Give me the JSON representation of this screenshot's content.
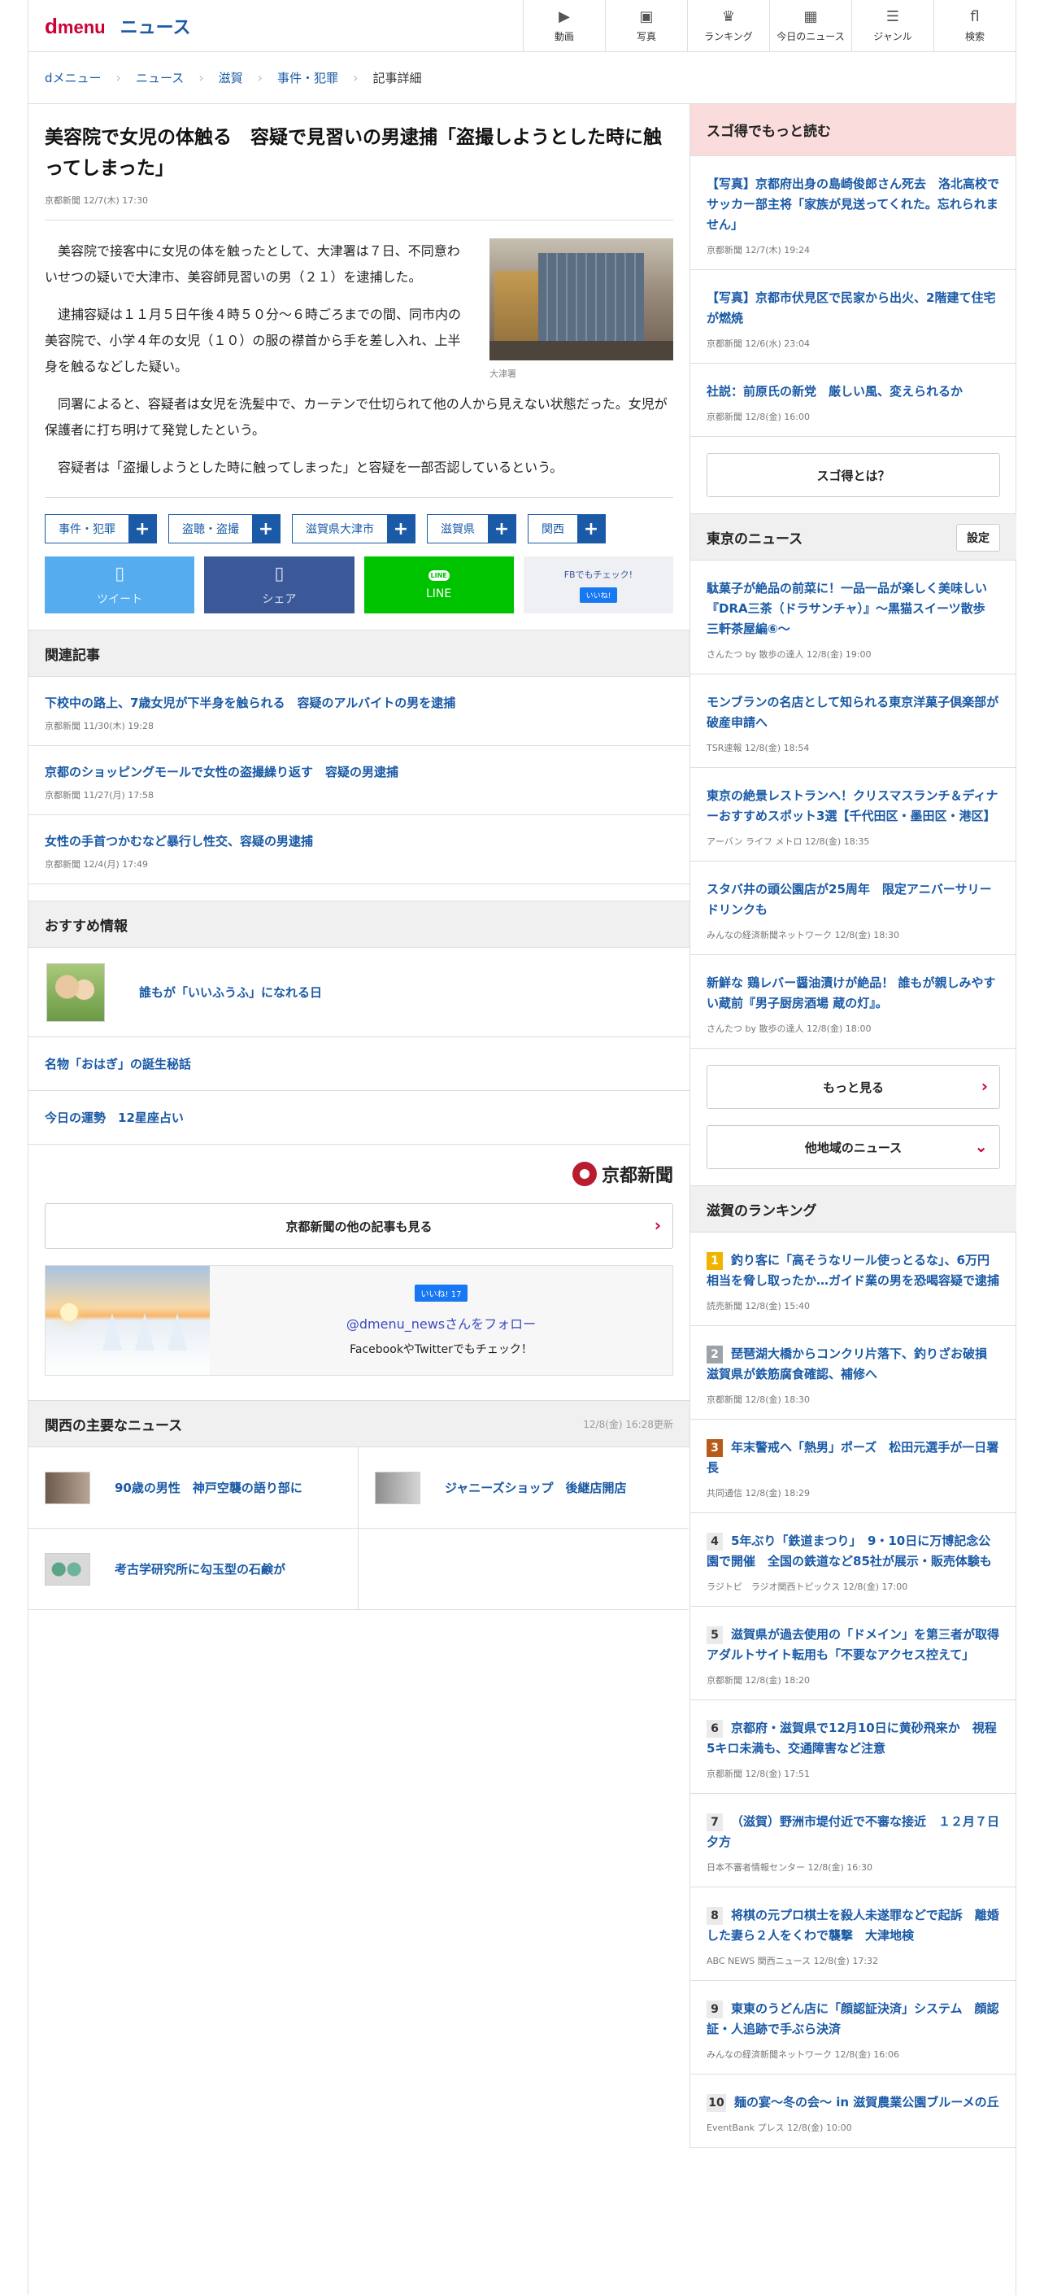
{
  "header": {
    "logo_d": "d",
    "logo_menu": "menu",
    "logo_news": "ニュース",
    "nav": [
      {
        "icon": "video-icon",
        "glyph": "▶",
        "label": "動画"
      },
      {
        "icon": "photo-icon",
        "glyph": "▣",
        "label": "写真"
      },
      {
        "icon": "ranking-icon",
        "glyph": "♛",
        "label": "ランキング"
      },
      {
        "icon": "calendar-icon",
        "glyph": "▦",
        "label": "今日のニュース"
      },
      {
        "icon": "genre-icon",
        "glyph": "☰",
        "label": "ジャンル"
      },
      {
        "icon": "search-icon",
        "glyph": "fl",
        "label": "検索"
      }
    ]
  },
  "breadcrumb": [
    "dメニュー",
    "ニュース",
    "滋賀",
    "事件・犯罪",
    "記事詳細"
  ],
  "article": {
    "title": "美容院で女児の体触る　容疑で見習いの男逮捕「盗撮しようとした時に触ってしまった」",
    "meta": "京都新聞 12/7(木) 17:30",
    "photo_caption": "大津署",
    "paragraphs": [
      "美容院で接客中に女児の体を触ったとして、大津署は７日、不同意わいせつの疑いで大津市、美容師見習いの男（２１）を逮捕した。",
      "逮捕容疑は１１月５日午後４時５０分～６時ごろまでの間、同市内の美容院で、小学４年の女児（１０）の服の襟首から手を差し入れ、上半身を触るなどした疑い。",
      "同署によると、容疑者は女児を洗髪中で、カーテンで仕切られて他の人から見えない状態だった。女児が保護者に打ち明けて発覚したという。",
      "容疑者は「盗撮しようとした時に触ってしまった」と容疑を一部否認しているという。"
    ],
    "tags": [
      "事件・犯罪",
      "盗聴・盗撮",
      "滋賀県大津市",
      "滋賀県",
      "関西"
    ],
    "share": {
      "tweet": "ツイート",
      "share": "シェア",
      "line_badge": "LINE",
      "line": "LINE",
      "fb_check": "FBでもチェック!",
      "fb_like": "いいね!"
    }
  },
  "related": {
    "heading": "関連記事",
    "items": [
      {
        "title": "下校中の路上、7歳女児が下半身を触られる　容疑のアルバイトの男を逮捕",
        "meta": "京都新聞 11/30(木) 19:28"
      },
      {
        "title": "京都のショッピングモールで女性の盗撮繰り返す　容疑の男逮捕",
        "meta": "京都新聞 11/27(月) 17:58"
      },
      {
        "title": "女性の手首つかむなど暴行し性交、容疑の男逮捕",
        "meta": "京都新聞 12/4(月) 17:49"
      }
    ]
  },
  "recommend": {
    "heading": "おすすめ情報",
    "items": [
      "誰もが「いいふうふ」になれる日",
      "名物「おはぎ」の誕生秘話",
      "今日の運勢　12星座占い"
    ]
  },
  "publisher": {
    "logo_text": "京都新聞",
    "more": "京都新聞の他の記事も見る"
  },
  "follow": {
    "like": "いいね! 17",
    "handle": "@dmenu_newsさんをフォロー",
    "note": "FacebookやTwitterでもチェック！"
  },
  "kansai": {
    "heading": "関西の主要なニュース",
    "time": "12/8(金) 16:28更新",
    "items": [
      "90歳の男性　神戸空襲の語り部に",
      "ジャニーズショップ　後継店開店",
      "考古学研究所に勾玉型の石鹸が"
    ]
  },
  "sidebar": {
    "sugo_heading": "スゴ得でもっと読む",
    "sugo_items": [
      {
        "title": "【写真】京都府出身の島崎俊郎さん死去　洛北高校でサッカー部主将「家族が見送ってくれた。忘れられません」",
        "meta": "京都新聞 12/7(木) 19:24"
      },
      {
        "title": "【写真】京都市伏見区で民家から出火、2階建て住宅が燃焼",
        "meta": "京都新聞 12/6(水) 23:04"
      },
      {
        "title": "社説：前原氏の新党　厳しい風、変えられるか",
        "meta": "京都新聞 12/8(金) 16:00"
      }
    ],
    "sugo_button": "スゴ得とは？",
    "tokyo_heading": "東京のニュース",
    "tokyo_settings": "設定",
    "tokyo_items": [
      {
        "title": "駄菓子が絶品の前菜に！一品一品が楽しく美味しい『DRA三茶（ドラサンチャ）』〜黒猫スイーツ散歩 三軒茶屋編⑥〜",
        "meta": "さんたつ by 散歩の達人 12/8(金) 19:00"
      },
      {
        "title": "モンブランの名店として知られる東京洋菓子倶楽部が破産申請へ",
        "meta": "TSR速報 12/8(金) 18:54"
      },
      {
        "title": "東京の絶景レストランへ！クリスマスランチ＆ディナーおすすめスポット3選【千代田区・墨田区・港区】",
        "meta": "アーバン ライフ メトロ 12/8(金) 18:35"
      },
      {
        "title": "スタバ井の頭公園店が25周年　限定アニバーサリードリンクも",
        "meta": "みんなの経済新聞ネットワーク 12/8(金) 18:30"
      },
      {
        "title": "新鮮な 鶏レバー醤油漬けが絶品！ 誰もが親しみやすい蔵前『男子厨房酒場 蔵の灯』。",
        "meta": "さんたつ by 散歩の達人 12/8(金) 18:00"
      }
    ],
    "more_button": "もっと見る",
    "other_button": "他地域のニュース",
    "ranking_heading": "滋賀のランキング",
    "ranking": [
      {
        "num": "1",
        "title": "釣り客に「高そうなリール使っとるな」、6万円相当を脅し取ったか…ガイド業の男を恐喝容疑で逮捕",
        "meta": "読売新聞 12/8(金) 15:40"
      },
      {
        "num": "2",
        "title": "琵琶湖大橋からコンクリ片落下、釣りざお破損　滋賀県が鉄筋腐食確認、補修へ",
        "meta": "京都新聞 12/8(金) 18:30"
      },
      {
        "num": "3",
        "title": "年末警戒へ「熱男」ポーズ　松田元選手が一日署長",
        "meta": "共同通信 12/8(金) 18:29"
      },
      {
        "num": "4",
        "title": "5年ぶり「鉄道まつり」　9・10日に万博記念公園で開催　全国の鉄道など85社が展示・販売体験も",
        "meta": "ラジトピ　ラジオ関西トピックス 12/8(金) 17:00"
      },
      {
        "num": "5",
        "title": "滋賀県が過去使用の「ドメイン」を第三者が取得　アダルトサイト転用も「不要なアクセス控えて」",
        "meta": "京都新聞 12/8(金) 18:20"
      },
      {
        "num": "6",
        "title": "京都府・滋賀県で12月10日に黄砂飛来か　視程5キロ未満も、交通障害など注意",
        "meta": "京都新聞 12/8(金) 17:51"
      },
      {
        "num": "7",
        "title": "（滋賀）野洲市堤付近で不審な接近　１２月７日夕方",
        "meta": "日本不審者情報センター 12/8(金) 16:30"
      },
      {
        "num": "8",
        "title": "将棋の元プロ棋士を殺人未遂罪などで起訴　離婚した妻ら２人をくわで襲撃　大津地検",
        "meta": "ABC NEWS 関西ニュース 12/8(金) 17:32"
      },
      {
        "num": "9",
        "title": "東東のうどん店に「顔認証決済」システム　顔認証・人追跡で手ぶら決済",
        "meta": "みんなの経済新聞ネットワーク 12/8(金) 16:06"
      },
      {
        "num": "10",
        "title": "麺の宴〜冬の会〜 in 滋賀農業公園ブルーメの丘",
        "meta": "EventBank プレス 12/8(金) 10:00"
      }
    ]
  }
}
